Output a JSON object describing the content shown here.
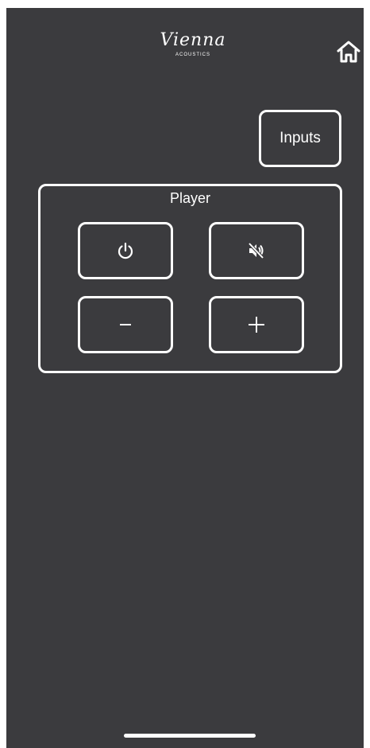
{
  "header": {
    "brand_script": "Vienna",
    "brand_sub": "ACOUSTICS",
    "home_icon": "home-icon"
  },
  "inputs_label": "Inputs",
  "player": {
    "title": "Player",
    "buttons": [
      {
        "name": "power",
        "icon": "power-icon"
      },
      {
        "name": "mute",
        "icon": "speaker-muted-icon"
      },
      {
        "name": "volume-down",
        "icon": "minus-icon"
      },
      {
        "name": "volume-up",
        "icon": "plus-icon"
      }
    ]
  },
  "colors": {
    "background": "#3b3b3e",
    "foreground": "#ffffff"
  }
}
